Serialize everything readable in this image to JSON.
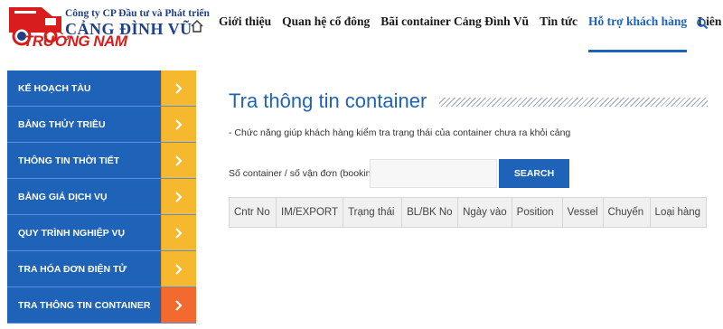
{
  "header": {
    "company_line": "Công ty CP Đầu tư và Phát triển",
    "brand": "CẢNG ĐÌNH VŨ",
    "nav_items": [
      {
        "label": "Giới thiệu"
      },
      {
        "label": "Quan hệ cổ đông"
      },
      {
        "label": "Bãi container Cảng Đình Vũ"
      },
      {
        "label": "Tin tức"
      },
      {
        "label": "Hỗ trợ khách hàng"
      },
      {
        "label": "Liên hệ"
      }
    ],
    "active_nav": "Hỗ trợ khách hàng",
    "icons": [
      "home-icon",
      "search-icon"
    ]
  },
  "watermark": {
    "text": "TRƯỜNG NAM"
  },
  "sidebar": {
    "items": [
      {
        "label": "KẾ HOẠCH TÀU"
      },
      {
        "label": "BẢNG THỦY TRIỀU"
      },
      {
        "label": "THÔNG TIN THỜI TIẾT"
      },
      {
        "label": "BẢNG GIÁ DỊCH VỤ"
      },
      {
        "label": "QUY TRÌNH NGHIỆP VỤ"
      },
      {
        "label": "TRA HÓA ĐƠN ĐIỆN TỬ"
      },
      {
        "label": "TRA THÔNG TIN CONTAINER"
      }
    ],
    "active_item": "TRA THÔNG TIN CONTAINER",
    "arrow_icon": "chevron-right-icon"
  },
  "main": {
    "title": "Tra thông tin container",
    "description": "- Chức năng giúp khách hàng kiểm tra trạng thái của container chưa ra khỏi cảng",
    "search": {
      "label": "Số container / số vận đơn (booking)",
      "value": "",
      "placeholder": "",
      "button_label": "SEARCH"
    },
    "table": {
      "columns": [
        "Cntr No",
        "IM/EXPORT",
        "Trạng thái",
        "BL/BK No",
        "Ngày vào",
        "Position",
        "Vessel",
        "Chuyến",
        "Loại hàng"
      ],
      "rows": []
    }
  },
  "colors": {
    "primary_blue": "#1f63b8",
    "arrow_yellow": "#f5b82e",
    "arrow_active_orange": "#f26a30",
    "brand_red": "#d91c1c"
  }
}
